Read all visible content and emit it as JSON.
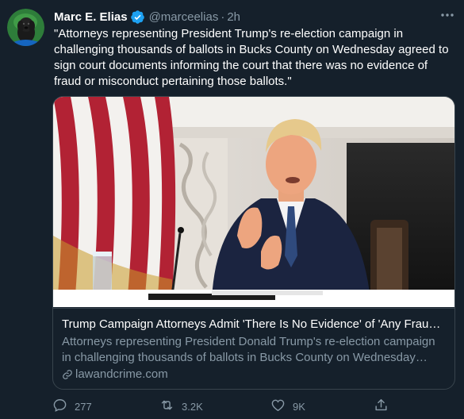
{
  "tweet": {
    "author": {
      "display_name": "Marc E. Elias",
      "handle": "@marceelias",
      "verified_icon": "verified-badge-icon",
      "avatar": "profile-photo-dog"
    },
    "separator": "·",
    "timestamp": "2h",
    "text": "\"Attorneys representing President Trump's re-election campaign in challenging thousands of ballots in Bucks County on Wednesday agreed to sign court documents informing the court that there was no evidence of fraud or misconduct pertaining those ballots.\"",
    "card": {
      "image": "photo-trump-speaking-at-table-with-flag",
      "title": "Trump Campaign Attorneys Admit 'There Is No Evidence' of 'Any Fraud' in Bucks County Ballot Challenge",
      "description": "Attorneys representing President Donald Trump's re-election campaign in challenging thousands of ballots in Bucks County on Wednesday agreed to sign court documents informing the court that there was no evidence.",
      "domain": "lawandcrime.com"
    },
    "actions": {
      "reply_count": "277",
      "retweet_count": "3.2K",
      "like_count": "9K"
    },
    "colors": {
      "background": "#15202b",
      "text_primary": "#ffffff",
      "text_secondary": "#8899a6",
      "border": "#38444d",
      "verified": "#1da1f2"
    }
  }
}
